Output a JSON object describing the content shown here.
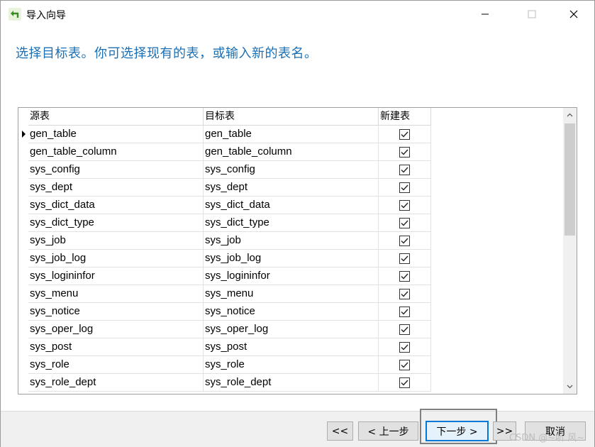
{
  "window": {
    "title": "导入向导",
    "controls": {
      "minimize": "minimize",
      "maximize": "maximize",
      "close": "close"
    }
  },
  "heading": "选择目标表。你可选择现有的表，或输入新的表名。",
  "grid": {
    "columns": {
      "source": "源表",
      "target": "目标表",
      "new_table": "新建表"
    },
    "rows": [
      {
        "source": "gen_table",
        "target": "gen_table",
        "new_table": true,
        "current": true
      },
      {
        "source": "gen_table_column",
        "target": "gen_table_column",
        "new_table": true
      },
      {
        "source": "sys_config",
        "target": "sys_config",
        "new_table": true
      },
      {
        "source": "sys_dept",
        "target": "sys_dept",
        "new_table": true
      },
      {
        "source": "sys_dict_data",
        "target": "sys_dict_data",
        "new_table": true
      },
      {
        "source": "sys_dict_type",
        "target": "sys_dict_type",
        "new_table": true
      },
      {
        "source": "sys_job",
        "target": "sys_job",
        "new_table": true
      },
      {
        "source": "sys_job_log",
        "target": "sys_job_log",
        "new_table": true
      },
      {
        "source": "sys_logininfor",
        "target": "sys_logininfor",
        "new_table": true
      },
      {
        "source": "sys_menu",
        "target": "sys_menu",
        "new_table": true
      },
      {
        "source": "sys_notice",
        "target": "sys_notice",
        "new_table": true
      },
      {
        "source": "sys_oper_log",
        "target": "sys_oper_log",
        "new_table": true
      },
      {
        "source": "sys_post",
        "target": "sys_post",
        "new_table": true
      },
      {
        "source": "sys_role",
        "target": "sys_role",
        "new_table": true
      },
      {
        "source": "sys_role_dept",
        "target": "sys_role_dept",
        "new_table": true
      }
    ]
  },
  "buttons": {
    "first": "<<",
    "prev": "< 上一步",
    "next": "下一步 >",
    "last": ">>",
    "cancel": "取消"
  },
  "watermark": "CSDN @~听 风~",
  "colors": {
    "heading": "#1a6fb5",
    "focus": "#0078d7"
  }
}
